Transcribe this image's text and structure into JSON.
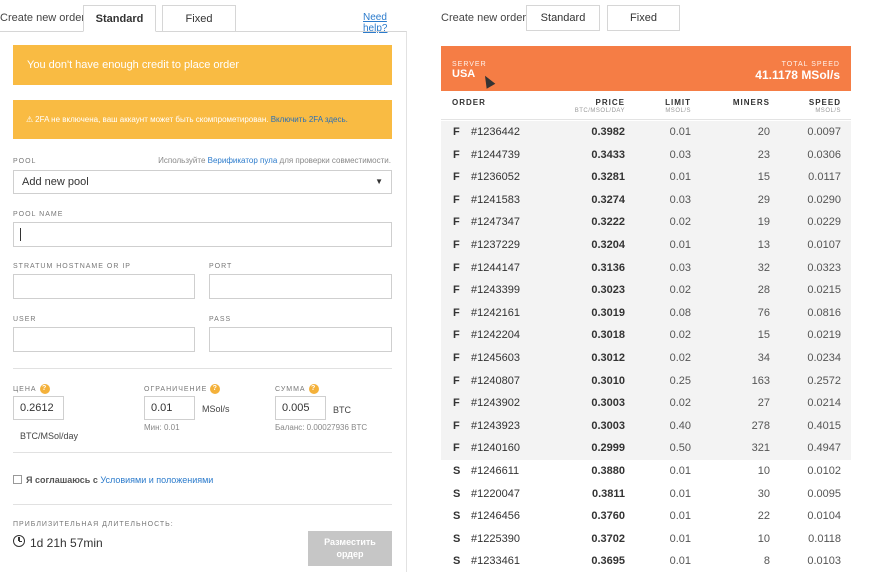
{
  "left": {
    "create_label": "Create new order",
    "tab_standard": "Standard",
    "tab_fixed": "Fixed",
    "need_help": "Need help?",
    "alert_credit": "You don't have enough credit to place order",
    "alert_2fa_text": "2FA не включена, ваш аккаунт может быть скомпрометирован.",
    "alert_2fa_link": "Включить 2FA здесь.",
    "pool_label": "POOL",
    "pool_hint_prefix": "Используйте",
    "pool_hint_link": "Верификатор пула",
    "pool_hint_suffix": "для проверки совместимости.",
    "pool_select_value": "Add new pool",
    "pool_name_label": "POOL NAME",
    "pool_name_value": "",
    "stratum_label": "STRATUM HOSTNAME OR IP",
    "stratum_value": "",
    "port_label": "PORT",
    "port_value": "",
    "user_label": "USER",
    "user_value": "",
    "pass_label": "PASS",
    "pass_value": "",
    "price_label": "ЦЕНА",
    "price_value": "0.2612",
    "price_unit": "BTC/MSol/day",
    "limit_label": "ОГРАНИЧЕНИЕ",
    "limit_value": "0.01",
    "limit_unit": "MSol/s",
    "limit_min": "Мин: 0.01",
    "amount_label": "СУММА",
    "amount_value": "0.005",
    "amount_unit": "BTC",
    "balance": "Баланс: 0.00027936 BTC",
    "agree_prefix": "Я соглашаюсь с",
    "agree_link": "Условиями и положениями",
    "duration_label": "ПРИБЛИЗИТЕЛЬНАЯ ДЛИТЕЛЬНОСТЬ:",
    "duration_value": "1d 21h 57min",
    "place_line1": "Разместить",
    "place_line2": "ордер"
  },
  "right": {
    "create_label": "Create new order",
    "tab_standard": "Standard",
    "tab_fixed": "Fixed",
    "server_label": "SERVER",
    "server_value": "USA",
    "total_speed_label": "TOTAL SPEED",
    "total_speed_value": "41.1178 MSol/s",
    "col_order": "ORDER",
    "col_price": "PRICE",
    "col_price_sub": "BTC/MSOL/DAY",
    "col_limit": "LIMIT",
    "col_limit_sub": "MSOL/S",
    "col_miners": "MINERS",
    "col_speed": "SPEED",
    "col_speed_sub": "MSOL/S",
    "rows": [
      {
        "type": "F",
        "id": "#1236442",
        "price": "0.3982",
        "limit": "0.01",
        "miners": "20",
        "speed": "0.0097"
      },
      {
        "type": "F",
        "id": "#1244739",
        "price": "0.3433",
        "limit": "0.03",
        "miners": "23",
        "speed": "0.0306"
      },
      {
        "type": "F",
        "id": "#1236052",
        "price": "0.3281",
        "limit": "0.01",
        "miners": "15",
        "speed": "0.0117"
      },
      {
        "type": "F",
        "id": "#1241583",
        "price": "0.3274",
        "limit": "0.03",
        "miners": "29",
        "speed": "0.0290"
      },
      {
        "type": "F",
        "id": "#1247347",
        "price": "0.3222",
        "limit": "0.02",
        "miners": "19",
        "speed": "0.0229"
      },
      {
        "type": "F",
        "id": "#1237229",
        "price": "0.3204",
        "limit": "0.01",
        "miners": "13",
        "speed": "0.0107"
      },
      {
        "type": "F",
        "id": "#1244147",
        "price": "0.3136",
        "limit": "0.03",
        "miners": "32",
        "speed": "0.0323"
      },
      {
        "type": "F",
        "id": "#1243399",
        "price": "0.3023",
        "limit": "0.02",
        "miners": "28",
        "speed": "0.0215"
      },
      {
        "type": "F",
        "id": "#1242161",
        "price": "0.3019",
        "limit": "0.08",
        "miners": "76",
        "speed": "0.0816"
      },
      {
        "type": "F",
        "id": "#1242204",
        "price": "0.3018",
        "limit": "0.02",
        "miners": "15",
        "speed": "0.0219"
      },
      {
        "type": "F",
        "id": "#1245603",
        "price": "0.3012",
        "limit": "0.02",
        "miners": "34",
        "speed": "0.0234"
      },
      {
        "type": "F",
        "id": "#1240807",
        "price": "0.3010",
        "limit": "0.25",
        "miners": "163",
        "speed": "0.2572"
      },
      {
        "type": "F",
        "id": "#1243902",
        "price": "0.3003",
        "limit": "0.02",
        "miners": "27",
        "speed": "0.0214"
      },
      {
        "type": "F",
        "id": "#1243923",
        "price": "0.3003",
        "limit": "0.40",
        "miners": "278",
        "speed": "0.4015"
      },
      {
        "type": "F",
        "id": "#1240160",
        "price": "0.2999",
        "limit": "0.50",
        "miners": "321",
        "speed": "0.4947"
      },
      {
        "type": "S",
        "id": "#1246611",
        "price": "0.3880",
        "limit": "0.01",
        "miners": "10",
        "speed": "0.0102"
      },
      {
        "type": "S",
        "id": "#1220047",
        "price": "0.3811",
        "limit": "0.01",
        "miners": "30",
        "speed": "0.0095"
      },
      {
        "type": "S",
        "id": "#1246456",
        "price": "0.3760",
        "limit": "0.01",
        "miners": "22",
        "speed": "0.0104"
      },
      {
        "type": "S",
        "id": "#1225390",
        "price": "0.3702",
        "limit": "0.01",
        "miners": "10",
        "speed": "0.0118"
      },
      {
        "type": "S",
        "id": "#1233461",
        "price": "0.3695",
        "limit": "0.01",
        "miners": "8",
        "speed": "0.0103"
      }
    ]
  },
  "colors": {
    "alert": "#f9bb43",
    "server_bar": "#f57d45",
    "link": "#2b7bcc",
    "disabled_button": "#c6c6c6"
  }
}
